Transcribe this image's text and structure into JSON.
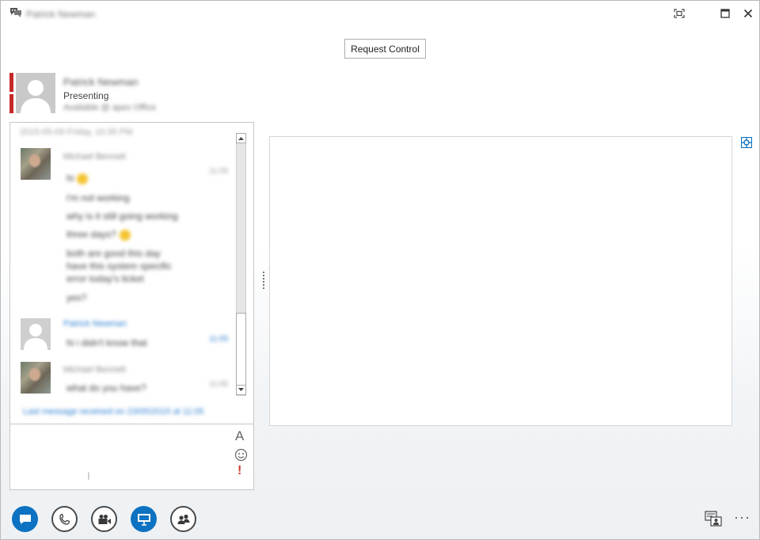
{
  "window": {
    "title": "Patrick Newman",
    "controls": {
      "fullscreen_icon": "fullscreen-icon",
      "maximize_icon": "maximize-icon",
      "close_icon": "close-icon"
    }
  },
  "toolbar": {
    "request_control_label": "Request Control"
  },
  "contact": {
    "name": "Patrick Newman",
    "status": "Presenting",
    "note": "Available @ apex Office",
    "presence_color": "#c62828"
  },
  "conversation": {
    "date_header": "2015-05-09 Friday, 10:35 PM",
    "groups": [
      {
        "sender": "Michael Bennett",
        "time": "11:05",
        "lines": [
          "hi",
          "i'm not working",
          "why is it still going working",
          "three days?",
          "both are good this day",
          "have this system specific",
          "error today's ticket",
          "yes?"
        ]
      },
      {
        "sender": "Patrick Newman",
        "time": "11:05",
        "lines": [
          "hi i didn't know that"
        ]
      },
      {
        "sender": "Michael Bennett",
        "time": "11:05",
        "lines": [
          "what do you have?"
        ]
      }
    ],
    "last_message_note": "Last message received on 23/05/2015 at 11:05"
  },
  "input": {
    "placeholder": ""
  },
  "colors": {
    "accent": "#0c72c1",
    "link": "#2a7dd1",
    "important": "#d13b2a"
  },
  "bottom_bar": {
    "buttons": [
      {
        "icon": "im-icon",
        "active": true
      },
      {
        "icon": "phone-icon",
        "active": false
      },
      {
        "icon": "video-icon",
        "active": false
      },
      {
        "icon": "present-icon",
        "active": true
      },
      {
        "icon": "participants-icon",
        "active": false
      }
    ],
    "more_label": "···"
  }
}
